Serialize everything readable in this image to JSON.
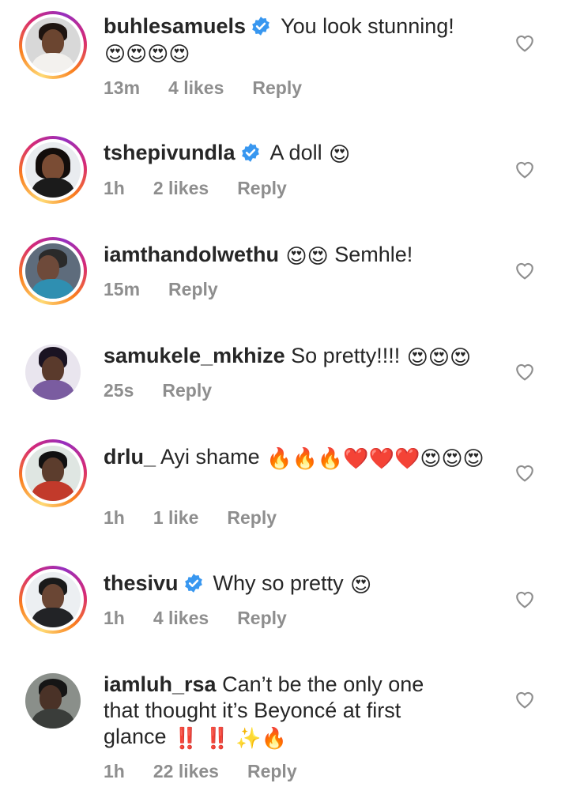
{
  "comments": [
    {
      "username": "buhlesamuels",
      "verified": true,
      "text": "You look stunning!",
      "emojis": "😍😍😍😍",
      "time": "13m",
      "likes": "4 likes",
      "reply": "Reply",
      "story_ring": true,
      "avatar_colors": {
        "bg": "#d8d8d8",
        "skin": "#6b4530",
        "hair": "#1e1410",
        "body": "#f3f1ee"
      }
    },
    {
      "username": "tshepivundla",
      "verified": true,
      "text": "A doll",
      "emojis": "😍",
      "time": "1h",
      "likes": "2 likes",
      "reply": "Reply",
      "story_ring": true,
      "avatar_colors": {
        "bg": "#e9ecef",
        "skin": "#7a4c34",
        "hair": "#130d0b",
        "body": "#1b1b1b"
      }
    },
    {
      "username": "iamthandolwethu",
      "verified": false,
      "text": "Semhle!",
      "emojis_before": "😍😍",
      "time": "15m",
      "likes": "",
      "reply": "Reply",
      "story_ring": true,
      "avatar_colors": {
        "bg": "#5e6c7c",
        "skin": "#6e4a3a",
        "hair": "#2a2a2a",
        "body": "#2f8fb1"
      }
    },
    {
      "username": "samukele_mkhize",
      "verified": false,
      "text": "So pretty!!!!",
      "emojis": "😍😍😍",
      "time": "25s",
      "likes": "",
      "reply": "Reply",
      "story_ring": false,
      "avatar_colors": {
        "bg": "#e9e5ee",
        "skin": "#5a3a2c",
        "hair": "#1a1322",
        "body": "#7a5ca0"
      }
    },
    {
      "username": "drlu_",
      "verified": false,
      "text": "Ayi shame",
      "emojis": "🔥🔥🔥❤️❤️❤️😍😍😍",
      "time": "1h",
      "likes": "1 like",
      "reply": "Reply",
      "story_ring": true,
      "avatar_colors": {
        "bg": "#dfe6e2",
        "skin": "#5c3d2d",
        "hair": "#111111",
        "body": "#c23a2b"
      }
    },
    {
      "username": "thesivu",
      "verified": true,
      "text": "Why so pretty",
      "emojis": "😍",
      "time": "1h",
      "likes": "4 likes",
      "reply": "Reply",
      "story_ring": true,
      "avatar_colors": {
        "bg": "#eceff2",
        "skin": "#6a4634",
        "hair": "#1a1a1a",
        "body": "#222326"
      }
    },
    {
      "username": "iamluh_rsa",
      "verified": false,
      "text": "Can’t be the only one that thought it’s Beyoncé at first glance",
      "emojis": "‼️ ‼️ ✨🔥",
      "time": "1h",
      "likes": "22 likes",
      "reply": "Reply",
      "story_ring": false,
      "avatar_colors": {
        "bg": "#8a8f8a",
        "skin": "#4a3227",
        "hair": "#151515",
        "body": "#3a3d3a"
      }
    }
  ],
  "colors": {
    "verified": "#3897f0",
    "meta": "#8e8e8e",
    "text": "#262626",
    "heart": "#8e8e8e"
  },
  "icons": {
    "verified": "verified-badge-icon",
    "like": "heart-outline-icon"
  }
}
